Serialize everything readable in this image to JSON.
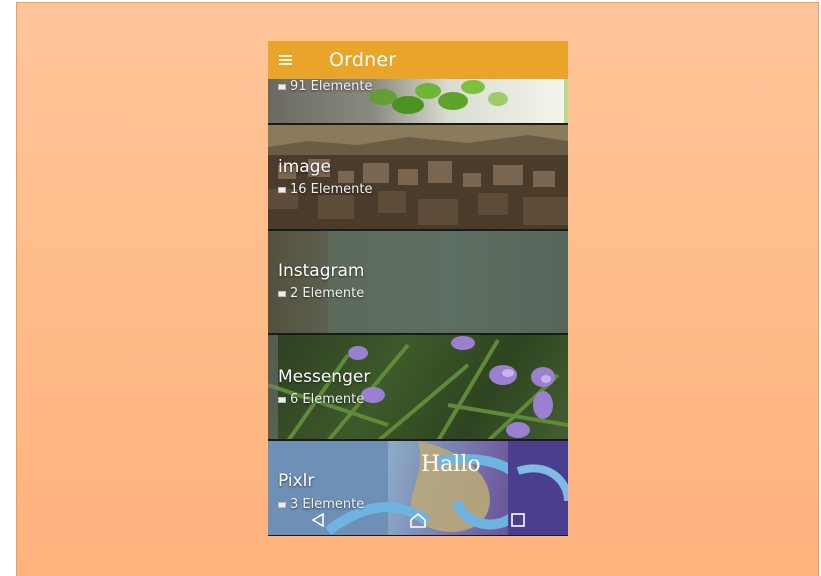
{
  "app": {
    "title": "Ordner"
  },
  "folders": [
    {
      "name": "",
      "count": "91 Elemente"
    },
    {
      "name": "image",
      "count": "16 Elemente"
    },
    {
      "name": "Instagram",
      "count": "2 Elemente"
    },
    {
      "name": "Messenger",
      "count": "6 Elemente"
    },
    {
      "name": "Pixlr",
      "count": "3 Elemente",
      "overlay_text": "Hallo"
    }
  ],
  "navigation": {
    "icons": [
      "back-icon",
      "home-icon",
      "recents-icon"
    ]
  },
  "colors": {
    "app_bar": "#e8a52a",
    "background": "#ffc08f"
  }
}
